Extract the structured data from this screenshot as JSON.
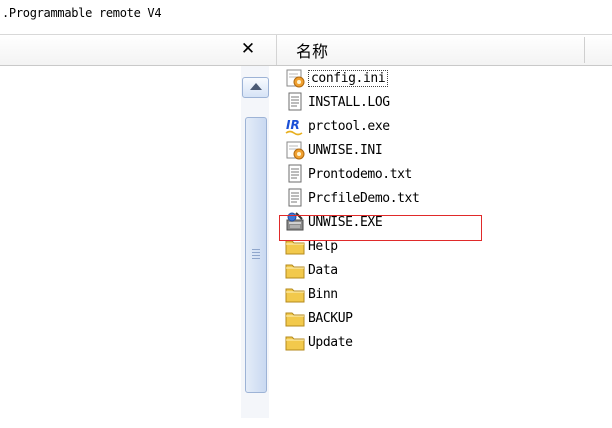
{
  "window": {
    "title": ".Programmable remote V4"
  },
  "header": {
    "close_glyph": "✕",
    "column_name": "名称"
  },
  "files": [
    {
      "name": "config.ini",
      "icon": "config-settings-icon"
    },
    {
      "name": "INSTALL.LOG",
      "icon": "text-document-icon"
    },
    {
      "name": "prctool.exe",
      "icon": "ir-app-icon"
    },
    {
      "name": "UNWISE.INI",
      "icon": "config-settings-icon"
    },
    {
      "name": "Prontodemo.txt",
      "icon": "text-document-icon"
    },
    {
      "name": "PrcfileDemo.txt",
      "icon": "text-document-icon"
    },
    {
      "name": "UNWISE.EXE",
      "icon": "installer-icon"
    },
    {
      "name": "Help",
      "icon": "folder-icon"
    },
    {
      "name": "Data",
      "icon": "folder-icon"
    },
    {
      "name": "Binn",
      "icon": "folder-icon"
    },
    {
      "name": "BACKUP",
      "icon": "folder-icon"
    },
    {
      "name": "Update",
      "icon": "folder-icon"
    }
  ],
  "colors": {
    "highlight": "#e02a2a",
    "folder": "#f2c94c",
    "ir_brand": "#1a4fd6"
  }
}
